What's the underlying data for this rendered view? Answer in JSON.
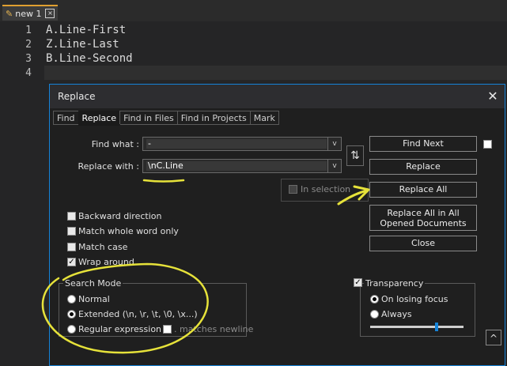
{
  "tab": {
    "name": "new 1",
    "close_glyph": "×",
    "icon": "pencil-icon"
  },
  "editor": {
    "line_numbers": [
      "1",
      "2",
      "3",
      "4"
    ],
    "lines": [
      "A.Line-First",
      "Z.Line-Last",
      "B.Line-Second",
      ""
    ]
  },
  "dialog": {
    "title": "Replace",
    "close_glyph": "✕",
    "tabs": [
      "Find",
      "Replace",
      "Find in Files",
      "Find in Projects",
      "Mark"
    ],
    "active_tab": "Replace",
    "find_label": "Find what :",
    "find_value": "-",
    "replace_label": "Replace with :",
    "replace_value": "\\nC.Line",
    "dropdown_glyph": "v",
    "swap_glyph": "⇅",
    "buttons": {
      "find_next": "Find Next",
      "replace": "Replace",
      "replace_all": "Replace All",
      "replace_all_opened": "Replace All in All Opened Documents",
      "close": "Close"
    },
    "in_selection": "In selection",
    "options": [
      {
        "label": "Backward direction",
        "checked": false
      },
      {
        "label": "Match whole word only",
        "checked": false
      },
      {
        "label": "Match case",
        "checked": false
      },
      {
        "label": "Wrap around",
        "checked": true
      }
    ],
    "check_glyph": "✓",
    "search_mode": {
      "title": "Search Mode",
      "modes": [
        {
          "label": "Normal",
          "selected": false
        },
        {
          "label": "Extended (\\n, \\r, \\t, \\0, \\x...)",
          "selected": true
        },
        {
          "label": "Regular expression",
          "selected": false
        }
      ],
      "matches_newline": ". matches newline"
    },
    "transparency": {
      "title": "Transparency",
      "enabled": true,
      "options": [
        {
          "label": "On losing focus",
          "selected": true
        },
        {
          "label": "Always",
          "selected": false
        }
      ],
      "slider_level": 0.72
    },
    "collapse_glyph": "^"
  },
  "colors": {
    "accent": "#1583d8",
    "annotation": "#e6e23a",
    "tab_marker": "#e0a030"
  }
}
